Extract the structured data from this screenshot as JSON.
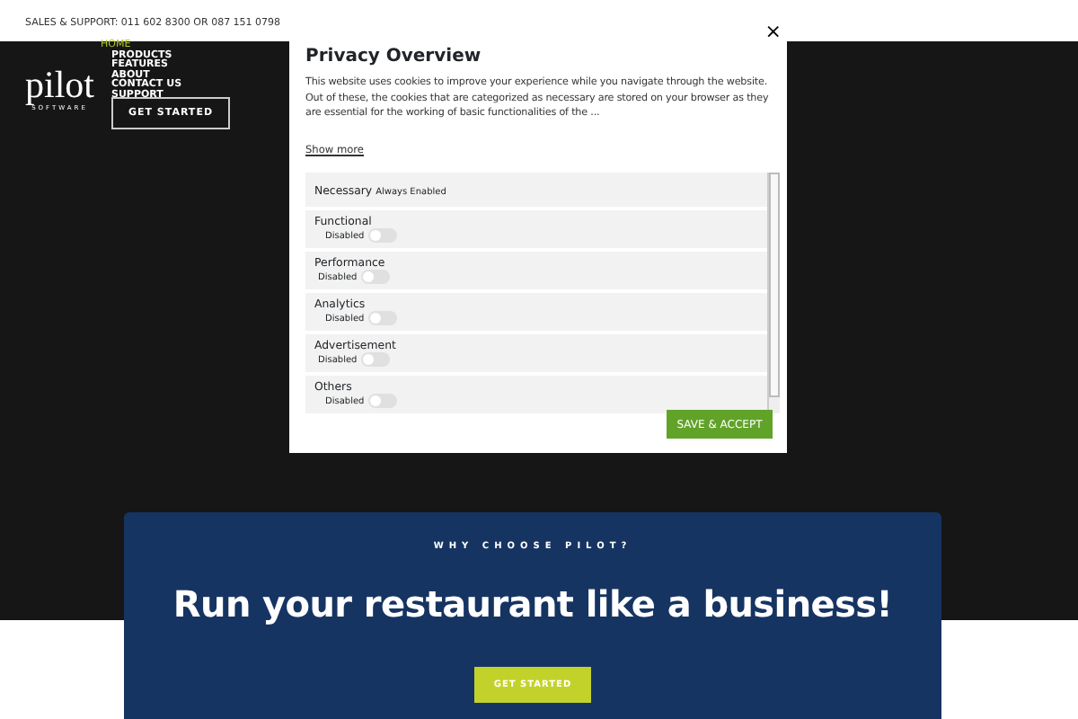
{
  "top_bar": {
    "text": "SALES & SUPPORT: 011 602 8300 OR 087 151 0798"
  },
  "logo": {
    "name": "pilot",
    "sub": "SOFTWARE"
  },
  "nav": [
    {
      "label": "HOME",
      "selected": true
    },
    {
      "label": "PRODUCTS",
      "selected": false
    },
    {
      "label": "FEATURES",
      "selected": false
    },
    {
      "label": "ABOUT",
      "selected": false
    },
    {
      "label": "CONTACT US",
      "selected": false
    },
    {
      "label": "SUPPORT",
      "selected": false
    }
  ],
  "header_button": "GET STARTED",
  "modal": {
    "close": "×",
    "title": "Privacy Overview",
    "text": "This website uses cookies to improve your experience while you navigate through the website. Out of these, the cookies that are categorized as necessary are stored on your browser as they are essential for the working of basic functionalities of the ...",
    "show_more": "Show more",
    "categories": [
      {
        "name": "Necessary",
        "kind": "always",
        "status": "Always Enabled"
      },
      {
        "name": "Functional",
        "kind": "toggle",
        "status": "Disabled",
        "on": false
      },
      {
        "name": "Performance",
        "kind": "toggle",
        "status": "Disabled",
        "on": false
      },
      {
        "name": "Analytics",
        "kind": "toggle",
        "status": "Disabled",
        "on": false
      },
      {
        "name": "Advertisement",
        "kind": "toggle",
        "status": "Disabled",
        "on": false
      },
      {
        "name": "Others",
        "kind": "toggle",
        "status": "Disabled",
        "on": false
      }
    ],
    "button": "SAVE & ACCEPT"
  },
  "cta": {
    "eyebrow": "WHY CHOOSE PILOT?",
    "heading": "Run your restaurant like a business!",
    "button": "GET STARTED"
  }
}
